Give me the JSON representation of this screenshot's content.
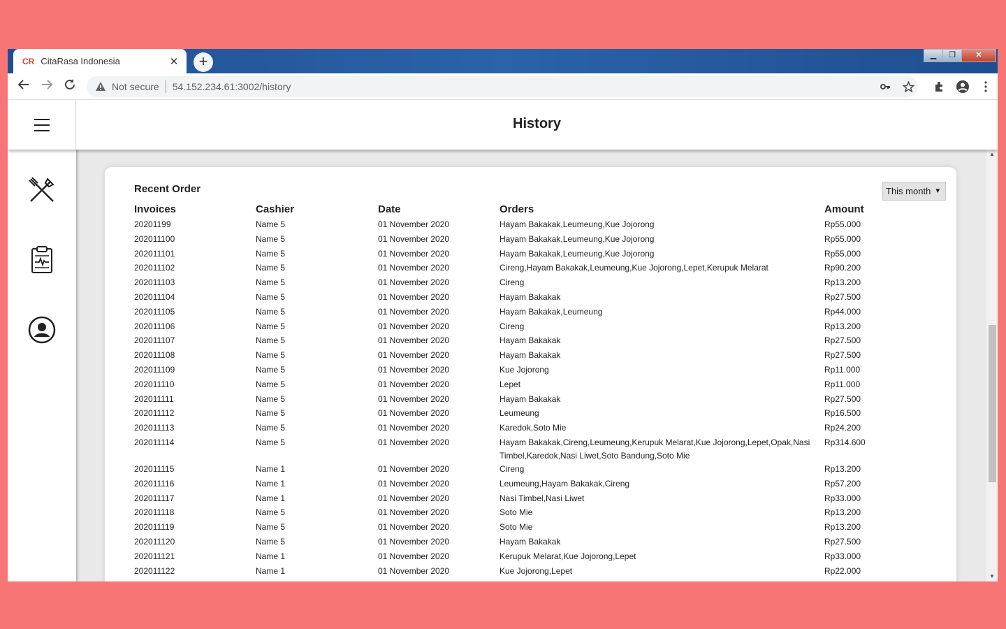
{
  "browser": {
    "tab_title": "CitaRasa Indonesia",
    "tab_favicon": "CR",
    "tab_close": "✕",
    "new_tab": "+",
    "security_label": "Not secure",
    "url": "54.152.234.61:3002/history"
  },
  "header": {
    "title": "History"
  },
  "sidebar": {
    "items": [
      "utensils-icon",
      "clipboard-icon",
      "profile-icon"
    ]
  },
  "card": {
    "title": "Recent Order",
    "period": "This month",
    "columns": [
      "Invoices",
      "Cashier",
      "Date",
      "Orders",
      "Amount"
    ],
    "rows": [
      [
        "20201199",
        "Name 5",
        "01 November 2020",
        "Hayam Bakakak,Leumeung,Kue Jojorong",
        "Rp55.000"
      ],
      [
        "202011100",
        "Name 5",
        "01 November 2020",
        "Hayam Bakakak,Leumeung,Kue Jojorong",
        "Rp55.000"
      ],
      [
        "202011101",
        "Name 5",
        "01 November 2020",
        "Hayam Bakakak,Leumeung,Kue Jojorong",
        "Rp55.000"
      ],
      [
        "202011102",
        "Name 5",
        "01 November 2020",
        "Cireng,Hayam Bakakak,Leumeung,Kue Jojorong,Lepet,Kerupuk Melarat",
        "Rp90.200"
      ],
      [
        "202011103",
        "Name 5",
        "01 November 2020",
        "Cireng",
        "Rp13.200"
      ],
      [
        "202011104",
        "Name 5",
        "01 November 2020",
        "Hayam Bakakak",
        "Rp27.500"
      ],
      [
        "202011105",
        "Name 5",
        "01 November 2020",
        "Hayam Bakakak,Leumeung",
        "Rp44.000"
      ],
      [
        "202011106",
        "Name 5",
        "01 November 2020",
        "Cireng",
        "Rp13.200"
      ],
      [
        "202011107",
        "Name 5",
        "01 November 2020",
        "Hayam Bakakak",
        "Rp27.500"
      ],
      [
        "202011108",
        "Name 5",
        "01 November 2020",
        "Hayam Bakakak",
        "Rp27.500"
      ],
      [
        "202011109",
        "Name 5",
        "01 November 2020",
        "Kue Jojorong",
        "Rp11.000"
      ],
      [
        "202011110",
        "Name 5",
        "01 November 2020",
        "Lepet",
        "Rp11.000"
      ],
      [
        "202011111",
        "Name 5",
        "01 November 2020",
        "Hayam Bakakak",
        "Rp27.500"
      ],
      [
        "202011112",
        "Name 5",
        "01 November 2020",
        "Leumeung",
        "Rp16.500"
      ],
      [
        "202011113",
        "Name 5",
        "01 November 2020",
        "Karedok,Soto Mie",
        "Rp24.200"
      ],
      [
        "202011114",
        "Name 5",
        "01 November 2020",
        "Hayam Bakakak,Cireng,Leumeung,Kerupuk Melarat,Kue Jojorong,Lepet,Opak,Nasi Timbel,Karedok,Nasi Liwet,Soto Bandung,Soto Mie",
        "Rp314.600"
      ],
      [
        "202011115",
        "Name 1",
        "01 November 2020",
        "Cireng",
        "Rp13.200"
      ],
      [
        "202011116",
        "Name 1",
        "01 November 2020",
        "Leumeung,Hayam Bakakak,Cireng",
        "Rp57.200"
      ],
      [
        "202011117",
        "Name 1",
        "01 November 2020",
        "Nasi Timbel,Nasi Liwet",
        "Rp33.000"
      ],
      [
        "202011118",
        "Name 5",
        "01 November 2020",
        "Soto Mie",
        "Rp13.200"
      ],
      [
        "202011119",
        "Name 5",
        "01 November 2020",
        "Soto Mie",
        "Rp13.200"
      ],
      [
        "202011120",
        "Name 5",
        "01 November 2020",
        "Hayam Bakakak",
        "Rp27.500"
      ],
      [
        "202011121",
        "Name 1",
        "01 November 2020",
        "Kerupuk Melarat,Kue Jojorong,Lepet",
        "Rp33.000"
      ],
      [
        "202011122",
        "Name 1",
        "01 November 2020",
        "Kue Jojorong,Lepet",
        "Rp22.000"
      ]
    ]
  }
}
